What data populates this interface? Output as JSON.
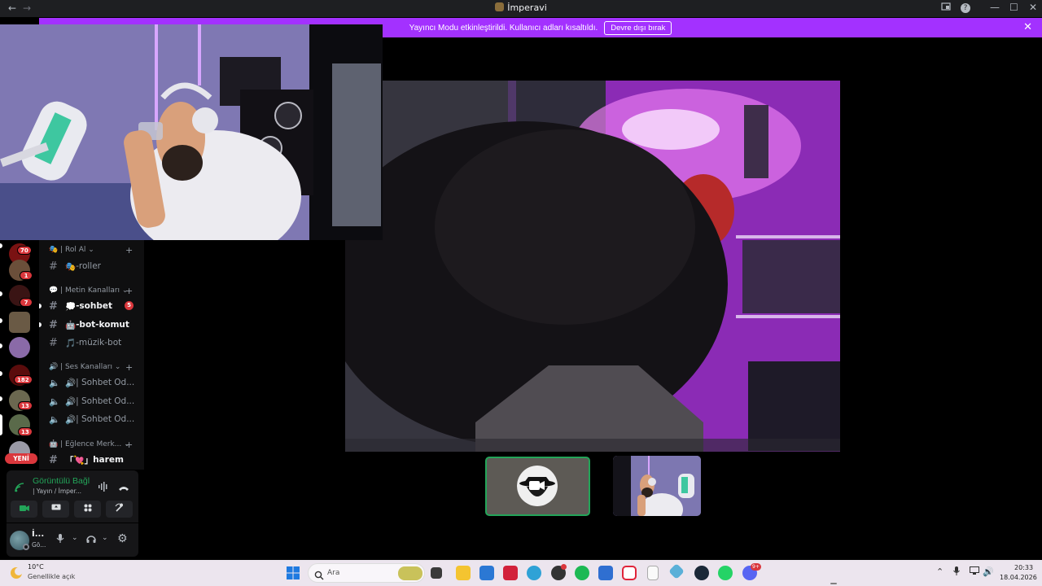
{
  "titlebar": {
    "title": "İmperavi",
    "back": "←",
    "forward": "→",
    "minimize": "—",
    "maximize": "☐",
    "close": "✕",
    "help": "?"
  },
  "banner": {
    "text": "Yayıncı Modu etkinleştirildi. Kullanıcı adları kısaltıldı.",
    "button": "Devre dışı bırak",
    "close": "✕"
  },
  "servers": [
    {
      "badge": "70"
    },
    {
      "badge": "1"
    },
    {
      "badge": "7"
    },
    {
      "badge": ""
    },
    {
      "badge": ""
    },
    {
      "badge": "182"
    },
    {
      "badge": "13"
    },
    {
      "badge": "13"
    }
  ],
  "new_badge": "YENİ",
  "channels": {
    "cat_roles": "| Rol Al",
    "ch_roles": "-roller",
    "cat_text": "| Metin Kanalları",
    "ch_chat": "-sohbet",
    "ch_chat_mentions": "5",
    "ch_bot": "-bot-komut",
    "ch_music": "-müzik-bot",
    "cat_voice": "| Ses Kanalları",
    "vc1": "| Sohbet Od...",
    "vc2": "| Sohbet Od...",
    "vc3": "| Sohbet Od...",
    "cat_fun": "| Eğlence Merk...",
    "ch_harem": "harem",
    "ch_harem_prefix": "「💘」"
  },
  "voice_panel": {
    "title": "Görüntülü Bağl",
    "subtitle": "| Yayın / İmper..."
  },
  "user_panel": {
    "name": "İ...",
    "status": "Gö..."
  },
  "taskbar": {
    "weather_temp": "10°C",
    "weather_desc": "Genellikle açık",
    "search_placeholder": "Ara",
    "time": "20:33",
    "date": "18.04.2026",
    "discord_badge": "9+"
  },
  "colors": {
    "banner": "#a331ff",
    "voice_connected": "#23a559",
    "badge_red": "#da373c"
  }
}
